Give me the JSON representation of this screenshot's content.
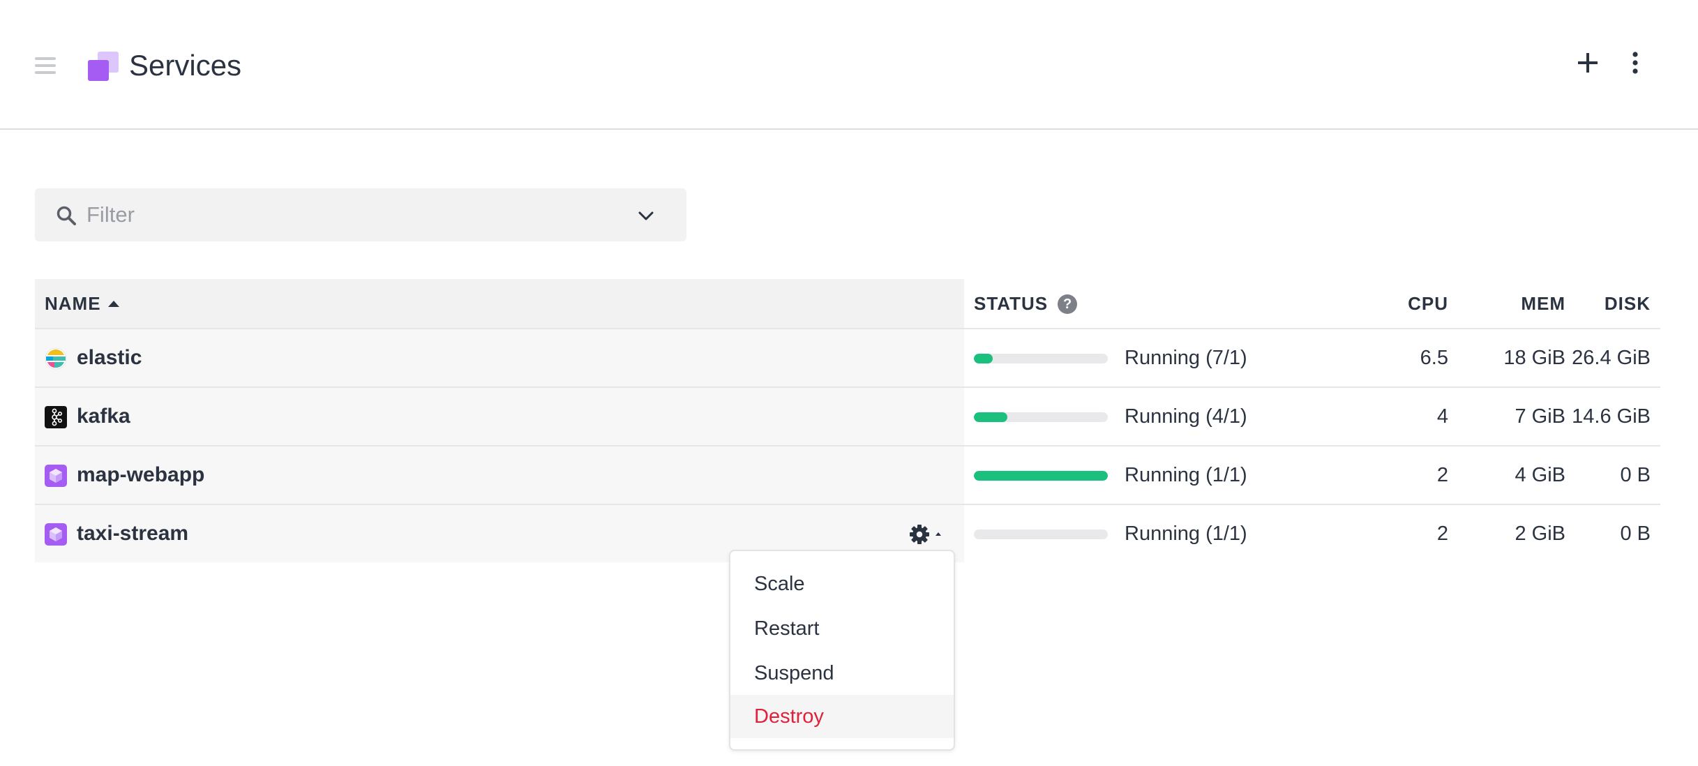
{
  "header": {
    "title": "Services",
    "hamburger_icon": "hamburger-icon",
    "services_icon": "services-icon",
    "add_icon": "plus-icon",
    "more_icon": "more-vertical-icon"
  },
  "filter": {
    "placeholder": "Filter",
    "value": ""
  },
  "table": {
    "columns": {
      "name": "NAME",
      "status": "STATUS",
      "cpu": "CPU",
      "mem": "MEM",
      "disk": "DISK"
    },
    "rows": [
      {
        "name": "elastic",
        "icon": "elastic-icon",
        "status": "Running (7/1)",
        "progress": 0.14,
        "cpu": "6.5",
        "mem": "18 GiB",
        "disk": "26.4 GiB"
      },
      {
        "name": "kafka",
        "icon": "kafka-icon",
        "status": "Running (4/1)",
        "progress": 0.25,
        "cpu": "4",
        "mem": "7 GiB",
        "disk": "14.6 GiB"
      },
      {
        "name": "map-webapp",
        "icon": "service-cube-icon",
        "status": "Running (1/1)",
        "progress": 1.0,
        "cpu": "2",
        "mem": "4 GiB",
        "disk": "0 B"
      },
      {
        "name": "taxi-stream",
        "icon": "service-cube-icon",
        "status": "Running (1/1)",
        "progress": 0.0,
        "cpu": "2",
        "mem": "2 GiB",
        "disk": "0 B"
      }
    ]
  },
  "actions_menu": {
    "items": [
      "Scale",
      "Restart",
      "Suspend",
      "Destroy"
    ]
  },
  "colors": {
    "accent_purple": "#9f5bf0",
    "progress_green": "#1bc07e",
    "danger_red": "#e0213a"
  }
}
